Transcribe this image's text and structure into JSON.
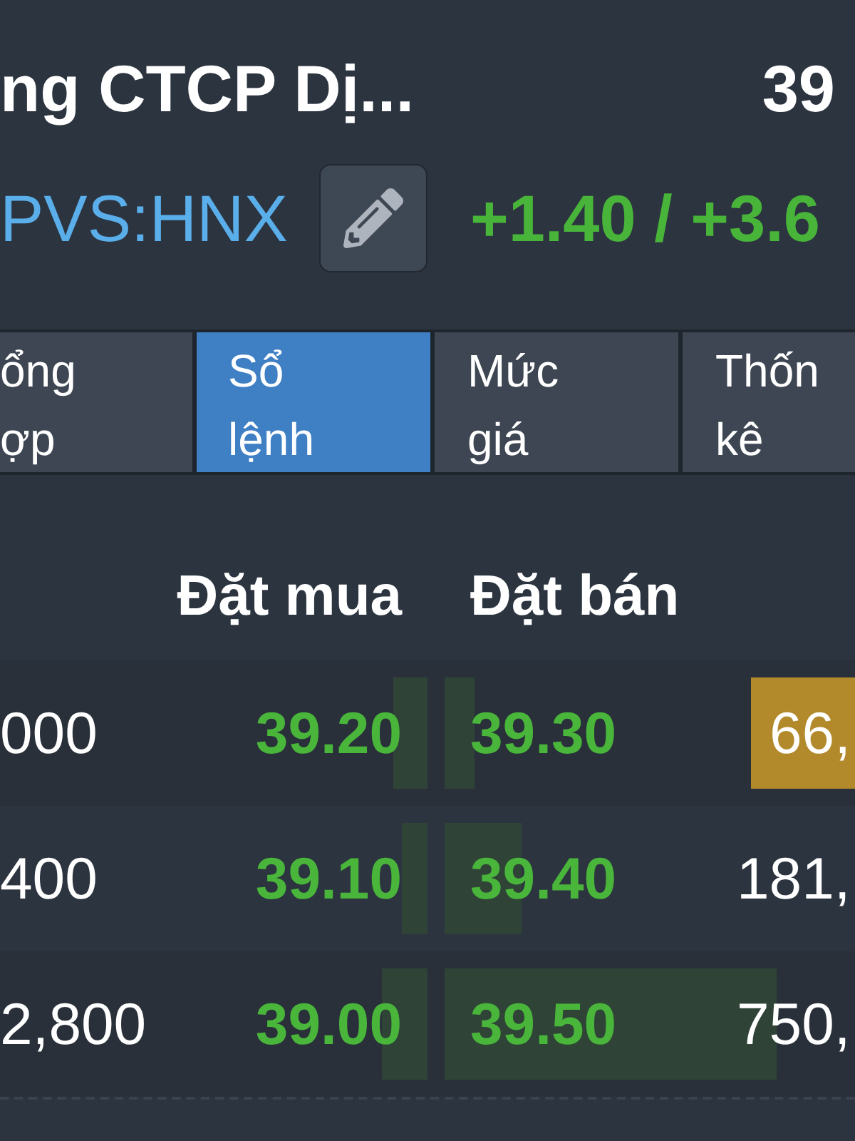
{
  "header": {
    "title": "ng CTCP Dị...",
    "price": "39",
    "ticker": "PVS:HNX",
    "change": "+1.40 / +3.6"
  },
  "tabs": [
    {
      "label": "ổng ợp",
      "selected": false
    },
    {
      "label": "Sổ lệnh",
      "selected": true
    },
    {
      "label": "Mức giá",
      "selected": false
    },
    {
      "label": "Thốn kê",
      "selected": false
    }
  ],
  "order_book": {
    "columns": [
      "Đặt mua",
      "Đặt bán"
    ],
    "rows": [
      {
        "column_1": "000",
        "bid": "39.20",
        "ask": "39.30",
        "column_4": "66,",
        "highlighted": true
      },
      {
        "column_1": "400",
        "bid": "39.10",
        "ask": "39.40",
        "column_4": "181,",
        "highlighted": false
      },
      {
        "column_1": "2,800",
        "bid": "39.00",
        "ask": "39.50",
        "column_4": "750,",
        "highlighted": false
      }
    ]
  }
}
